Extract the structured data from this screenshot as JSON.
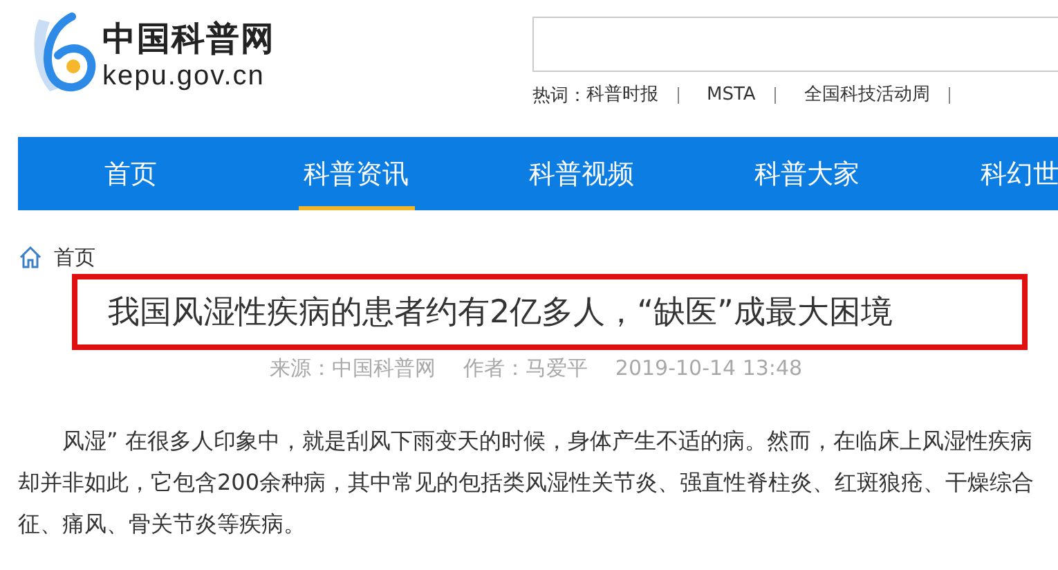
{
  "logo": {
    "name": "中国科普网",
    "domain": "kepu.gov.cn"
  },
  "hot_words": {
    "label": "热词：",
    "items": [
      "科普时报",
      "MSTA",
      "全国科技活动周"
    ]
  },
  "nav": [
    {
      "label": "首页",
      "selected": false
    },
    {
      "label": "科普资讯",
      "selected": true
    },
    {
      "label": "科普视频",
      "selected": false
    },
    {
      "label": "科普大家",
      "selected": false
    },
    {
      "label": "科幻世",
      "selected": false
    }
  ],
  "breadcrumb": "首页",
  "article": {
    "title": "我国风湿性疾病的患者约有2亿多人，“缺医”成最大困境",
    "highlighted": true,
    "source": "来源：中国科普网",
    "author": "作者：马爱平",
    "date": "2019-10-14 13:48",
    "paragraph": "风湿” 在很多人印象中，就是刮风下雨变天的时候，身体产生不适的病。然而，在临床上风湿性疾病却并非如此，它包含200余种病，其中常见的包括类风湿性关节炎、强直性脊柱炎、红斑狼疮、干燥综合征、痛风、骨关节炎等疾病。"
  }
}
